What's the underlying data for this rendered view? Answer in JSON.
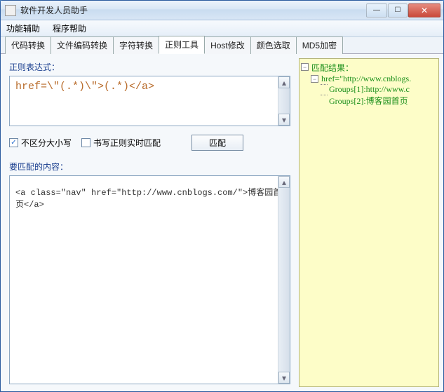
{
  "window": {
    "title": "软件开发人员助手"
  },
  "menu": {
    "item1": "功能辅助",
    "item2": "程序帮助"
  },
  "tabs": {
    "t0": "代码转换",
    "t1": "文件编码转换",
    "t2": "字符转换",
    "t3": "正则工具",
    "t4": "Host修改",
    "t5": "颜色选取",
    "t6": "MD5加密"
  },
  "regex": {
    "label": "正则表达式：",
    "value": "href=\\\"(.*)\\\">(.*)</a>",
    "cb_ignorecase": "不区分大小写",
    "cb_ignorecase_checked": true,
    "cb_realtime": "书写正则实时匹配",
    "cb_realtime_checked": false,
    "btn_match": "匹配",
    "content_label": "要匹配的内容：",
    "content_value": "<a class=\"nav\" href=\"http://www.cnblogs.com/\">博客园首页</a>"
  },
  "tree": {
    "root": "匹配结果：",
    "match": "href=\"http://www.cnblogs.",
    "group1": "Groups[1]:http://www.c",
    "group2": "Groups[2]:博客园首页"
  }
}
